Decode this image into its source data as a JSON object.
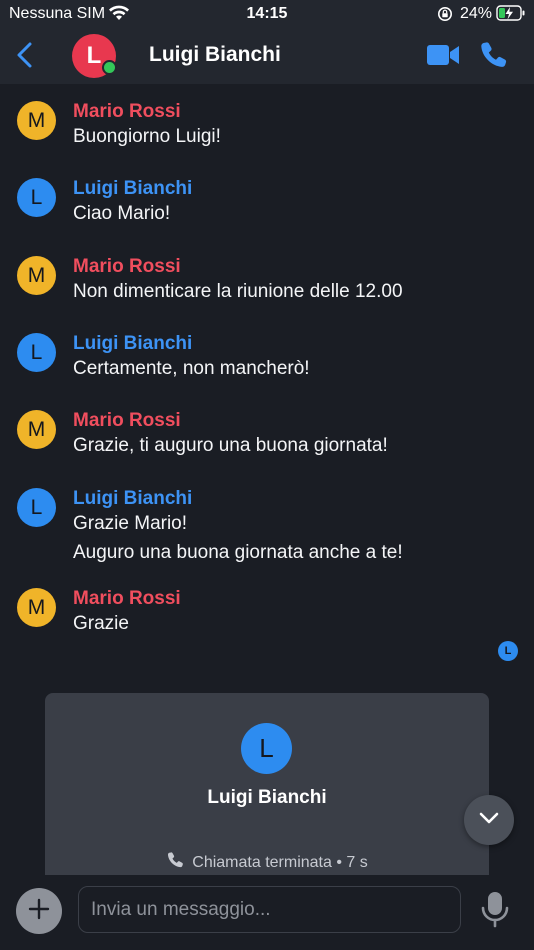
{
  "status_bar": {
    "carrier": "Nessuna SIM",
    "time": "14:15",
    "battery": "24%"
  },
  "header": {
    "back_icon": "chevron-left-icon",
    "avatar_letter": "L",
    "title": "Luigi Bianchi",
    "video_icon": "video-camera-icon",
    "call_icon": "phone-icon"
  },
  "colors": {
    "accent": "#3d93f5",
    "mario": "#f04e5e",
    "luigi": "#3d93f5",
    "online": "#34c759"
  },
  "messages": [
    {
      "avatar": "M",
      "sender": "Mario Rossi",
      "lines": [
        "Buongiorno Luigi!"
      ]
    },
    {
      "avatar": "L",
      "sender": "Luigi Bianchi",
      "lines": [
        "Ciao Mario!"
      ]
    },
    {
      "avatar": "M",
      "sender": "Mario Rossi",
      "lines": [
        "Non dimenticare la riunione delle 12.00"
      ]
    },
    {
      "avatar": "L",
      "sender": "Luigi Bianchi",
      "lines": [
        "Certamente, non mancherò!"
      ]
    },
    {
      "avatar": "M",
      "sender": "Mario Rossi",
      "lines": [
        "Grazie, ti auguro una buona giornata!"
      ]
    },
    {
      "avatar": "L",
      "sender": "Luigi Bianchi",
      "lines": [
        "Grazie Mario!",
        "Auguro una buona giornata anche a te!"
      ]
    },
    {
      "avatar": "M",
      "sender": "Mario Rossi",
      "lines": [
        "Grazie"
      ]
    }
  ],
  "read_receipt": "L",
  "call_card": {
    "avatar_letter": "L",
    "name": "Luigi Bianchi",
    "status": "Chiamata terminata",
    "duration": "7 s"
  },
  "composer": {
    "placeholder": "Invia un messaggio...",
    "add_icon": "plus-icon",
    "mic_icon": "microphone-icon"
  }
}
